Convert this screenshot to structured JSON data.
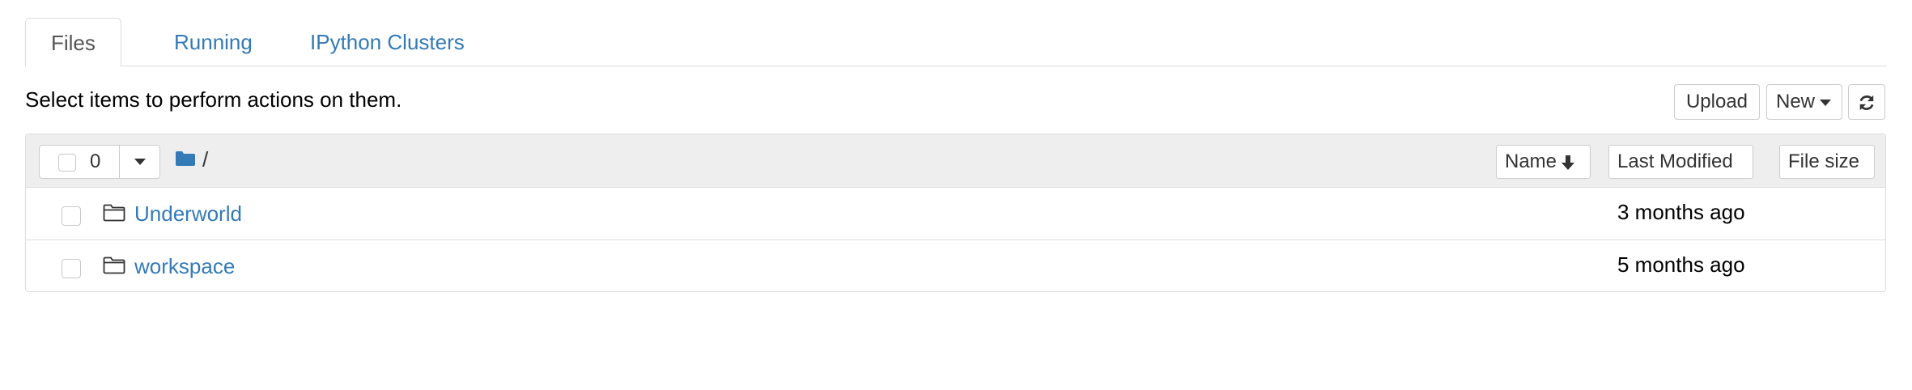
{
  "tabs": [
    {
      "label": "Files",
      "active": true
    },
    {
      "label": "Running",
      "active": false
    },
    {
      "label": "IPython Clusters",
      "active": false
    }
  ],
  "toolbar": {
    "instructions": "Select items to perform actions on them.",
    "upload_label": "Upload",
    "new_label": "New",
    "refresh_icon": "refresh-icon"
  },
  "list_header": {
    "selected_count": "0",
    "breadcrumb_icon": "folder-icon",
    "breadcrumb_path": "/",
    "sort_name_label": "Name",
    "sort_modified_label": "Last Modified",
    "sort_size_label": "File size"
  },
  "items": [
    {
      "name": "Underworld",
      "type": "folder",
      "modified": "3 months ago"
    },
    {
      "name": "workspace",
      "type": "folder",
      "modified": "5 months ago"
    }
  ],
  "colors": {
    "link": "#337ab7",
    "header_bg": "#eeeeee",
    "border": "#dddddd"
  }
}
